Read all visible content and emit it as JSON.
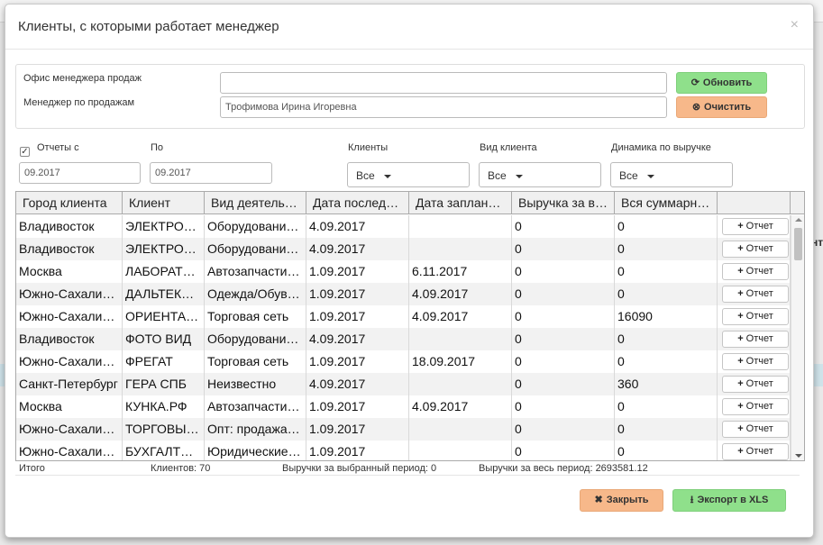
{
  "background": {
    "edge_text": "нт"
  },
  "modal": {
    "title": "Клиенты, с которыми работает менеджер",
    "close_glyph": "×"
  },
  "filters": {
    "office_label": "Офис менеджера продаж",
    "office_value": "",
    "manager_label": "Менеджер по продажам",
    "manager_value": "Трофимова Ирина Игоревна",
    "refresh_label": "Обновить",
    "clear_label": "Очистить",
    "reports_from_label": "Отчеты с",
    "reports_from_checked": true,
    "date_from": "09.2017",
    "to_label": "По",
    "date_to": "09.2017",
    "clients_label": "Клиенты",
    "clients_value": "Все",
    "client_type_label": "Вид клиента",
    "client_type_value": "Все",
    "revenue_dynamics_label": "Динамика по выручке",
    "revenue_dynamics_value": "Все"
  },
  "grid": {
    "columns": [
      "Город клиента",
      "Клиент",
      "Вид деятельности",
      "Дата последнего отчета",
      "Дата запланированного отчета",
      "Выручка за выбранный период",
      "Вся суммарная выручка",
      ""
    ],
    "columns_display": [
      "Город клиента",
      "Клиент",
      "Вид деятель…",
      "Дата последн…",
      "Дата заплани…",
      "Выручка за в…",
      "Вся суммарн…",
      ""
    ],
    "report_button_label": "Отчет",
    "rows": [
      [
        "Владивосток",
        "ЭЛЕКТРО…",
        "Оборудовани…",
        "4.09.2017",
        "",
        "0",
        "0"
      ],
      [
        "Владивосток",
        "ЭЛЕКТРО…",
        "Оборудовани…",
        "4.09.2017",
        "",
        "0",
        "0"
      ],
      [
        "Москва",
        "ЛАБОРАТ…",
        "Автозапчасти/…",
        "1.09.2017",
        "6.11.2017",
        "0",
        "0"
      ],
      [
        "Южно-Сахали…",
        "ДАЛЬТЕК…",
        "Одежда/Обув…",
        "1.09.2017",
        "4.09.2017",
        "0",
        "0"
      ],
      [
        "Южно-Сахали…",
        "ОРИЕНТА…",
        "Торговая сеть",
        "1.09.2017",
        "4.09.2017",
        "0",
        "16090"
      ],
      [
        "Владивосток",
        "ФОТО ВИД",
        "Оборудовани…",
        "4.09.2017",
        "",
        "0",
        "0"
      ],
      [
        "Южно-Сахали…",
        "ФРЕГАТ",
        "Торговая сеть",
        "1.09.2017",
        "18.09.2017",
        "0",
        "0"
      ],
      [
        "Санкт-Петербург",
        "ГЕРА СПБ",
        "Неизвестно",
        "4.09.2017",
        "",
        "0",
        "360"
      ],
      [
        "Москва",
        "КУНКА.РФ",
        "Автозапчасти/…",
        "1.09.2017",
        "4.09.2017",
        "0",
        "0"
      ],
      [
        "Южно-Сахали…",
        "ТОРГОВЫ…",
        "Опт: продажа …",
        "1.09.2017",
        "",
        "0",
        "0"
      ],
      [
        "Южно-Сахали…",
        "БУХГАЛТЕ…",
        "Юридические,…",
        "1.09.2017",
        "",
        "0",
        "0"
      ]
    ]
  },
  "summary": {
    "total_label": "Итого",
    "clients_count": "Клиентов: 70",
    "period_revenue": "Выручки за выбранный период: 0",
    "total_revenue": "Выручки за весь период: 2693581.12"
  },
  "footer": {
    "close_label": "Закрыть",
    "export_label": "Экспорт в XLS"
  },
  "colors": {
    "green_button": "#8fe08b",
    "orange_button": "#f7b88a"
  }
}
